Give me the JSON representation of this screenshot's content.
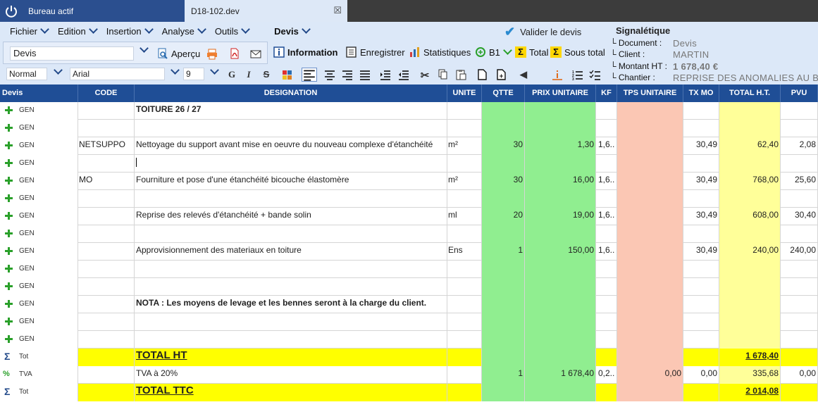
{
  "tabs": {
    "bureau": "Bureau actif",
    "document": "D18-102.dev"
  },
  "menu": {
    "items": [
      "Fichier",
      "Edition",
      "Insertion",
      "Analyse",
      "Outils"
    ],
    "devis": "Devis",
    "valider": "Valider le devis"
  },
  "toolbar": {
    "doc_type": "Devis",
    "apercu": "Aperçu",
    "information": "Information",
    "enregistrer": "Enregistrer",
    "statistiques": "Statistiques",
    "b1": "B1",
    "total": "Total",
    "sous_total": "Sous total"
  },
  "format": {
    "style": "Normal",
    "font": "Arial",
    "size": "9"
  },
  "signaletique": {
    "title": "Signalétique",
    "document_label": "Document :",
    "document": "Devis",
    "client_label": "Client :",
    "client": "MARTIN",
    "montant_label": "Montant HT :",
    "montant": "1 678,40 €",
    "chantier_label": "Chantier :",
    "chantier": "REPRISE DES ANOMALIES AU BA"
  },
  "columns": {
    "devis": "Devis",
    "code": "CODE",
    "designation": "DESIGNATION",
    "unite": "UNITE",
    "qtte": "QTTE",
    "pu": "PRIX UNITAIRE",
    "kf": "KF",
    "tps": "TPS UNITAIRE",
    "txmo": "TX MO",
    "total": "TOTAL H.T.",
    "pvu": "PVU"
  },
  "rows": [
    {
      "type": "GEN",
      "code": "",
      "desig": "TOITURE 26 / 27",
      "unite": "",
      "qtte": "",
      "pu": "",
      "kf": "",
      "tps": "",
      "txmo": "",
      "total": "",
      "pvu": ""
    },
    {
      "type": "GEN",
      "code": "",
      "desig": "",
      "unite": "",
      "qtte": "",
      "pu": "",
      "kf": "",
      "tps": "",
      "txmo": "",
      "total": "",
      "pvu": ""
    },
    {
      "type": "GEN",
      "code": "NETSUPPO",
      "desig": "Nettoyage du support avant mise en oeuvre du nouveau complexe d'étanchéité",
      "unite": "m²",
      "qtte": "30",
      "pu": "1,30",
      "kf": "1,6..",
      "tps": "",
      "txmo": "30,49",
      "total": "62,40",
      "pvu": "2,08"
    },
    {
      "type": "GEN",
      "code": "",
      "desig": "",
      "unite": "",
      "qtte": "",
      "pu": "",
      "kf": "",
      "tps": "",
      "txmo": "",
      "total": "",
      "pvu": ""
    },
    {
      "type": "GEN",
      "code": "MO",
      "desig": "Fourniture et pose d'une étanchéité bicouche élastomère",
      "unite": "m²",
      "qtte": "30",
      "pu": "16,00",
      "kf": "1,6..",
      "tps": "",
      "txmo": "30,49",
      "total": "768,00",
      "pvu": "25,60"
    },
    {
      "type": "GEN",
      "code": "",
      "desig": "",
      "unite": "",
      "qtte": "",
      "pu": "",
      "kf": "",
      "tps": "",
      "txmo": "",
      "total": "",
      "pvu": ""
    },
    {
      "type": "GEN",
      "code": "",
      "desig": "Reprise des relevés d'étanchéité + bande solin",
      "unite": "ml",
      "qtte": "20",
      "pu": "19,00",
      "kf": "1,6..",
      "tps": "",
      "txmo": "30,49",
      "total": "608,00",
      "pvu": "30,40"
    },
    {
      "type": "GEN",
      "code": "",
      "desig": "",
      "unite": "",
      "qtte": "",
      "pu": "",
      "kf": "",
      "tps": "",
      "txmo": "",
      "total": "",
      "pvu": ""
    },
    {
      "type": "GEN",
      "code": "",
      "desig": "Approvisionnement des materiaux en toiture",
      "unite": "Ens",
      "qtte": "1",
      "pu": "150,00",
      "kf": "1,6..",
      "tps": "",
      "txmo": "30,49",
      "total": "240,00",
      "pvu": "240,00"
    },
    {
      "type": "GEN",
      "code": "",
      "desig": "",
      "unite": "",
      "qtte": "",
      "pu": "",
      "kf": "",
      "tps": "",
      "txmo": "",
      "total": "",
      "pvu": ""
    },
    {
      "type": "GEN",
      "code": "",
      "desig": "",
      "unite": "",
      "qtte": "",
      "pu": "",
      "kf": "",
      "tps": "",
      "txmo": "",
      "total": "",
      "pvu": ""
    },
    {
      "type": "GEN",
      "code": "",
      "desig": "NOTA : Les moyens de levage et les bennes seront à la charge du client.",
      "unite": "",
      "qtte": "",
      "pu": "",
      "kf": "",
      "tps": "",
      "txmo": "",
      "total": "",
      "pvu": ""
    },
    {
      "type": "GEN",
      "code": "",
      "desig": "",
      "unite": "",
      "qtte": "",
      "pu": "",
      "kf": "",
      "tps": "",
      "txmo": "",
      "total": "",
      "pvu": ""
    },
    {
      "type": "GEN",
      "code": "",
      "desig": "",
      "unite": "",
      "qtte": "",
      "pu": "",
      "kf": "",
      "tps": "",
      "txmo": "",
      "total": "",
      "pvu": ""
    },
    {
      "type": "Tot",
      "code": "",
      "desig": "TOTAL HT",
      "unite": "",
      "qtte": "",
      "pu": "",
      "kf": "",
      "tps": "",
      "txmo": "",
      "total": "1 678,40",
      "pvu": ""
    },
    {
      "type": "TVA",
      "code": "",
      "desig": "TVA à 20%",
      "unite": "",
      "qtte": "1",
      "pu": "1 678,40",
      "kf": "0,2..",
      "tps": "0,00",
      "txmo": "0,00",
      "total": "335,68",
      "pvu": "0,00"
    },
    {
      "type": "Tot",
      "code": "",
      "desig": "TOTAL TTC",
      "unite": "",
      "qtte": "",
      "pu": "",
      "kf": "",
      "tps": "",
      "txmo": "",
      "total": "2 014,08",
      "pvu": ""
    }
  ]
}
